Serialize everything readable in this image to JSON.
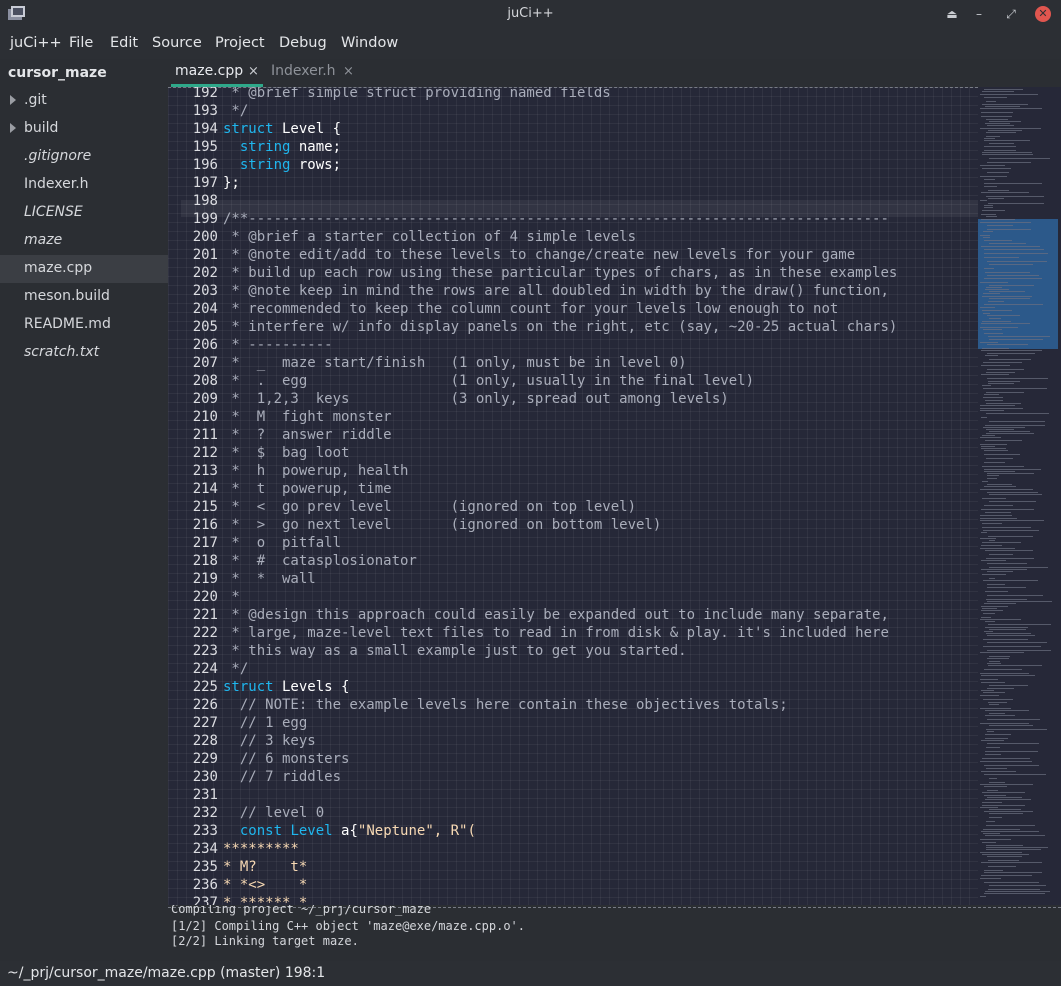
{
  "window": {
    "title": "juCi++"
  },
  "menu": [
    "juCi++",
    "File",
    "Edit",
    "Source",
    "Project",
    "Debug",
    "Window"
  ],
  "sidebar": {
    "project": "cursor_maze",
    "items": [
      {
        "label": ".git",
        "folder": true,
        "italic": false,
        "selected": false
      },
      {
        "label": "build",
        "folder": true,
        "italic": false,
        "selected": false
      },
      {
        "label": ".gitignore",
        "folder": false,
        "italic": true,
        "selected": false
      },
      {
        "label": "Indexer.h",
        "folder": false,
        "italic": false,
        "selected": false
      },
      {
        "label": "LICENSE",
        "folder": false,
        "italic": true,
        "selected": false
      },
      {
        "label": "maze",
        "folder": false,
        "italic": true,
        "selected": false
      },
      {
        "label": "maze.cpp",
        "folder": false,
        "italic": false,
        "selected": true
      },
      {
        "label": "meson.build",
        "folder": false,
        "italic": false,
        "selected": false
      },
      {
        "label": "README.md",
        "folder": false,
        "italic": false,
        "selected": false
      },
      {
        "label": "scratch.txt",
        "folder": false,
        "italic": true,
        "selected": false
      }
    ]
  },
  "tabs": [
    {
      "label": "maze.cpp",
      "close": "×",
      "active": true
    },
    {
      "label": "Indexer.h",
      "close": "×",
      "active": false
    }
  ],
  "editor": {
    "lines": [
      {
        "n": "192",
        "t": [
          [
            "c",
            " * @brief simple struct providing named fields"
          ]
        ]
      },
      {
        "n": "193",
        "t": [
          [
            "c",
            " */"
          ]
        ]
      },
      {
        "n": "194",
        "t": [
          [
            "k",
            "struct"
          ],
          [
            "p",
            " Level {"
          ]
        ]
      },
      {
        "n": "195",
        "t": [
          [
            "p",
            "  "
          ],
          [
            "k",
            "string"
          ],
          [
            "p",
            " name;"
          ]
        ]
      },
      {
        "n": "196",
        "t": [
          [
            "p",
            "  "
          ],
          [
            "k",
            "string"
          ],
          [
            "p",
            " rows;"
          ]
        ]
      },
      {
        "n": "197",
        "t": [
          [
            "p",
            "};"
          ]
        ]
      },
      {
        "n": "198",
        "t": []
      },
      {
        "n": "199",
        "t": [
          [
            "c",
            "/**----------------------------------------------------------------------------"
          ]
        ]
      },
      {
        "n": "200",
        "t": [
          [
            "c",
            " * @brief a starter collection of 4 simple levels"
          ]
        ]
      },
      {
        "n": "201",
        "t": [
          [
            "c",
            " * @note edit/add to these levels to change/create new levels for your game"
          ]
        ]
      },
      {
        "n": "202",
        "t": [
          [
            "c",
            " * build up each row using these particular types of chars, as in these examples"
          ]
        ]
      },
      {
        "n": "203",
        "t": [
          [
            "c",
            " * @note keep in mind the rows are all doubled in width by the draw() function,"
          ]
        ]
      },
      {
        "n": "204",
        "t": [
          [
            "c",
            " * recommended to keep the column count for your levels low enough to not"
          ]
        ]
      },
      {
        "n": "205",
        "t": [
          [
            "c",
            " * interfere w/ info display panels on the right, etc (say, ~20-25 actual chars)"
          ]
        ]
      },
      {
        "n": "206",
        "t": [
          [
            "c",
            " * ----------"
          ]
        ]
      },
      {
        "n": "207",
        "t": [
          [
            "c",
            " *  _  maze start/finish   (1 only, must be in level 0)"
          ]
        ]
      },
      {
        "n": "208",
        "t": [
          [
            "c",
            " *  .  egg                 (1 only, usually in the final level)"
          ]
        ]
      },
      {
        "n": "209",
        "t": [
          [
            "c",
            " *  1,2,3  keys            (3 only, spread out among levels)"
          ]
        ]
      },
      {
        "n": "210",
        "t": [
          [
            "c",
            " *  M  fight monster"
          ]
        ]
      },
      {
        "n": "211",
        "t": [
          [
            "c",
            " *  ?  answer riddle"
          ]
        ]
      },
      {
        "n": "212",
        "t": [
          [
            "c",
            " *  $  bag loot"
          ]
        ]
      },
      {
        "n": "213",
        "t": [
          [
            "c",
            " *  h  powerup, health"
          ]
        ]
      },
      {
        "n": "214",
        "t": [
          [
            "c",
            " *  t  powerup, time"
          ]
        ]
      },
      {
        "n": "215",
        "t": [
          [
            "c",
            " *  <  go prev level       (ignored on top level)"
          ]
        ]
      },
      {
        "n": "216",
        "t": [
          [
            "c",
            " *  >  go next level       (ignored on bottom level)"
          ]
        ]
      },
      {
        "n": "217",
        "t": [
          [
            "c",
            " *  o  pitfall"
          ]
        ]
      },
      {
        "n": "218",
        "t": [
          [
            "c",
            " *  #  catasplosionator"
          ]
        ]
      },
      {
        "n": "219",
        "t": [
          [
            "c",
            " *  *  wall"
          ]
        ]
      },
      {
        "n": "220",
        "t": [
          [
            "c",
            " *"
          ]
        ]
      },
      {
        "n": "221",
        "t": [
          [
            "c",
            " * @design this approach could easily be expanded out to include many separate,"
          ]
        ]
      },
      {
        "n": "222",
        "t": [
          [
            "c",
            " * large, maze-level text files to read in from disk & play. it's included here"
          ]
        ]
      },
      {
        "n": "223",
        "t": [
          [
            "c",
            " * this way as a small example just to get you started."
          ]
        ]
      },
      {
        "n": "224",
        "t": [
          [
            "c",
            " */"
          ]
        ]
      },
      {
        "n": "225",
        "t": [
          [
            "k",
            "struct"
          ],
          [
            "p",
            " Levels {"
          ]
        ]
      },
      {
        "n": "226",
        "t": [
          [
            "c",
            "  // NOTE: the example levels here contain these objectives totals;"
          ]
        ]
      },
      {
        "n": "227",
        "t": [
          [
            "c",
            "  // 1 egg"
          ]
        ]
      },
      {
        "n": "228",
        "t": [
          [
            "c",
            "  // 3 keys"
          ]
        ]
      },
      {
        "n": "229",
        "t": [
          [
            "c",
            "  // 6 monsters"
          ]
        ]
      },
      {
        "n": "230",
        "t": [
          [
            "c",
            "  // 7 riddles"
          ]
        ]
      },
      {
        "n": "231",
        "t": []
      },
      {
        "n": "232",
        "t": [
          [
            "c",
            "  // level 0"
          ]
        ]
      },
      {
        "n": "233",
        "t": [
          [
            "p",
            "  "
          ],
          [
            "k",
            "const"
          ],
          [
            "p",
            " "
          ],
          [
            "k",
            "Level"
          ],
          [
            "p",
            " a{"
          ],
          [
            "s",
            "\"Neptune\", R\"("
          ]
        ]
      },
      {
        "n": "234",
        "t": [
          [
            "s",
            "*********"
          ]
        ]
      },
      {
        "n": "235",
        "t": [
          [
            "s",
            "* M?    t*"
          ]
        ]
      },
      {
        "n": "236",
        "t": [
          [
            "s",
            "* *<>    *"
          ]
        ]
      },
      {
        "n": "237",
        "t": [
          [
            "s",
            "* ****** *"
          ]
        ]
      }
    ]
  },
  "terminal": [
    "Compiling project ~/_prj/cursor_maze",
    "[1/2] Compiling C++ object 'maze@exe/maze.cpp.o'.",
    "[2/2] Linking target maze."
  ],
  "status": "~/_prj/cursor_maze/maze.cpp (master) 198:1"
}
